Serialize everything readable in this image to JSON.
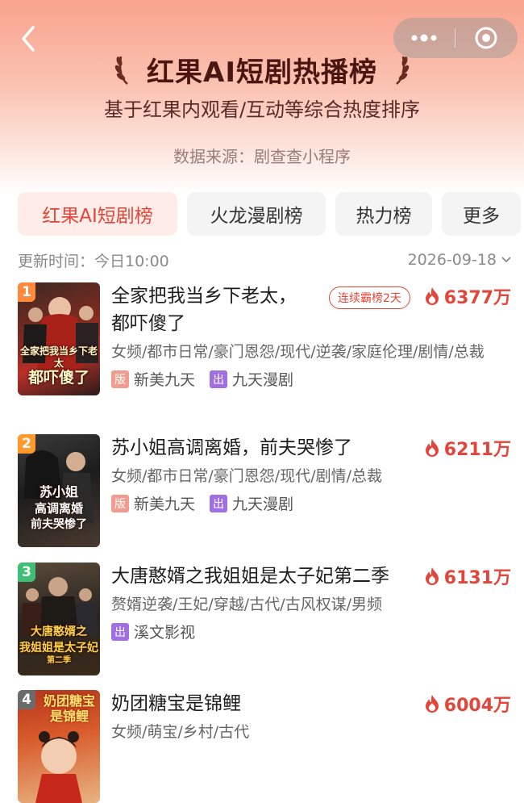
{
  "header": {
    "title": "红果AI短剧热播榜",
    "subtitle": "基于红果内观看/互动等综合热度排序",
    "source": "数据来源：剧查查小程序"
  },
  "tabs": [
    {
      "label": "红果AI短剧榜",
      "active": true
    },
    {
      "label": "火龙漫剧榜",
      "active": false
    },
    {
      "label": "热力榜",
      "active": false
    },
    {
      "label": "更多",
      "active": false
    }
  ],
  "update": {
    "label": "更新时间：今日10:00",
    "date": "2026-09-18"
  },
  "colors": {
    "accent": "#e2463a",
    "rank1": "#ff8a3d",
    "rank2": "#ff9a2e",
    "rank3": "#3fbf74",
    "rank4": "#6b6b6b"
  },
  "items": [
    {
      "rank": "1",
      "title_line1": "全家把我当乡下老太，",
      "title_line2": "都吓傻了",
      "streak": "连续霸榜2天",
      "heat": "6377万",
      "tags": "女频/都市日常/豪门恩怨/现代/逆袭/家庭伦理/剧情/总裁",
      "publisher": "新美九天",
      "producer": "九天漫剧",
      "cover_line1": "全家把我当乡下老太",
      "cover_line2": "都吓傻了"
    },
    {
      "rank": "2",
      "title_line1": "苏小姐高调离婚，前夫哭惨了",
      "heat": "6211万",
      "tags": "女频/都市日常/豪门恩怨/现代/剧情/总裁",
      "publisher": "新美九天",
      "producer": "九天漫剧",
      "cover_line1": "苏小姐",
      "cover_line2": "高调离婚",
      "cover_line3": "前夫哭惨了"
    },
    {
      "rank": "3",
      "title_line1": "大唐憨婿之我姐姐是太子妃第二季",
      "heat": "6131万",
      "tags": "赘婿逆袭/王妃/穿越/古代/古风权谋/男频",
      "producer": "溪文影视",
      "cover_line1": "大唐憨婿之",
      "cover_line2": "我姐姐是太子妃",
      "cover_line3": "第二季"
    },
    {
      "rank": "4",
      "title_line1": "奶团糖宝是锦鲤",
      "heat": "6004万",
      "tags": "女频/萌宝/乡村/古代",
      "cover_line1": "奶团糖宝",
      "cover_line2": "是锦鲤"
    }
  ],
  "badges": {
    "publisher": "版",
    "producer": "出"
  },
  "icons": [
    "back-icon",
    "more-dots-icon",
    "close-circle-icon",
    "laurel-left-icon",
    "laurel-right-icon",
    "chevron-down-icon",
    "flame-icon"
  ]
}
